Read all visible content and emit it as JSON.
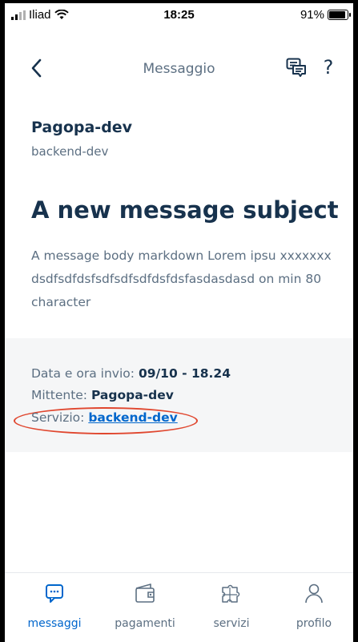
{
  "status_bar": {
    "carrier": "Iliad",
    "time": "18:25",
    "battery": "91%"
  },
  "header": {
    "title": "Messaggio"
  },
  "message": {
    "organization": "Pagopa-dev",
    "service": "backend-dev",
    "subject": "A new message subject",
    "body": "A message body markdown Lorem ipsu xxxxxxx dsdfsdfdsfsdfsdfsdfdsfdsfasdasdasd on min 80 character"
  },
  "details": {
    "date_label": "Data e ora invio: ",
    "date_value": "09/10 - 18.24",
    "sender_label": "Mittente: ",
    "sender_value": "Pagopa-dev",
    "service_label": "Servizio: ",
    "service_value": "backend-dev"
  },
  "nav": {
    "items": [
      {
        "label": "messaggi",
        "icon": "message-icon",
        "active": true
      },
      {
        "label": "pagamenti",
        "icon": "wallet-icon",
        "active": false
      },
      {
        "label": "servizi",
        "icon": "puzzle-icon",
        "active": false
      },
      {
        "label": "profilo",
        "icon": "user-icon",
        "active": false
      }
    ]
  },
  "colors": {
    "accent": "#0066cc",
    "text_dark": "#17324d",
    "text_muted": "#5c6f82",
    "highlight": "#e0472f"
  }
}
